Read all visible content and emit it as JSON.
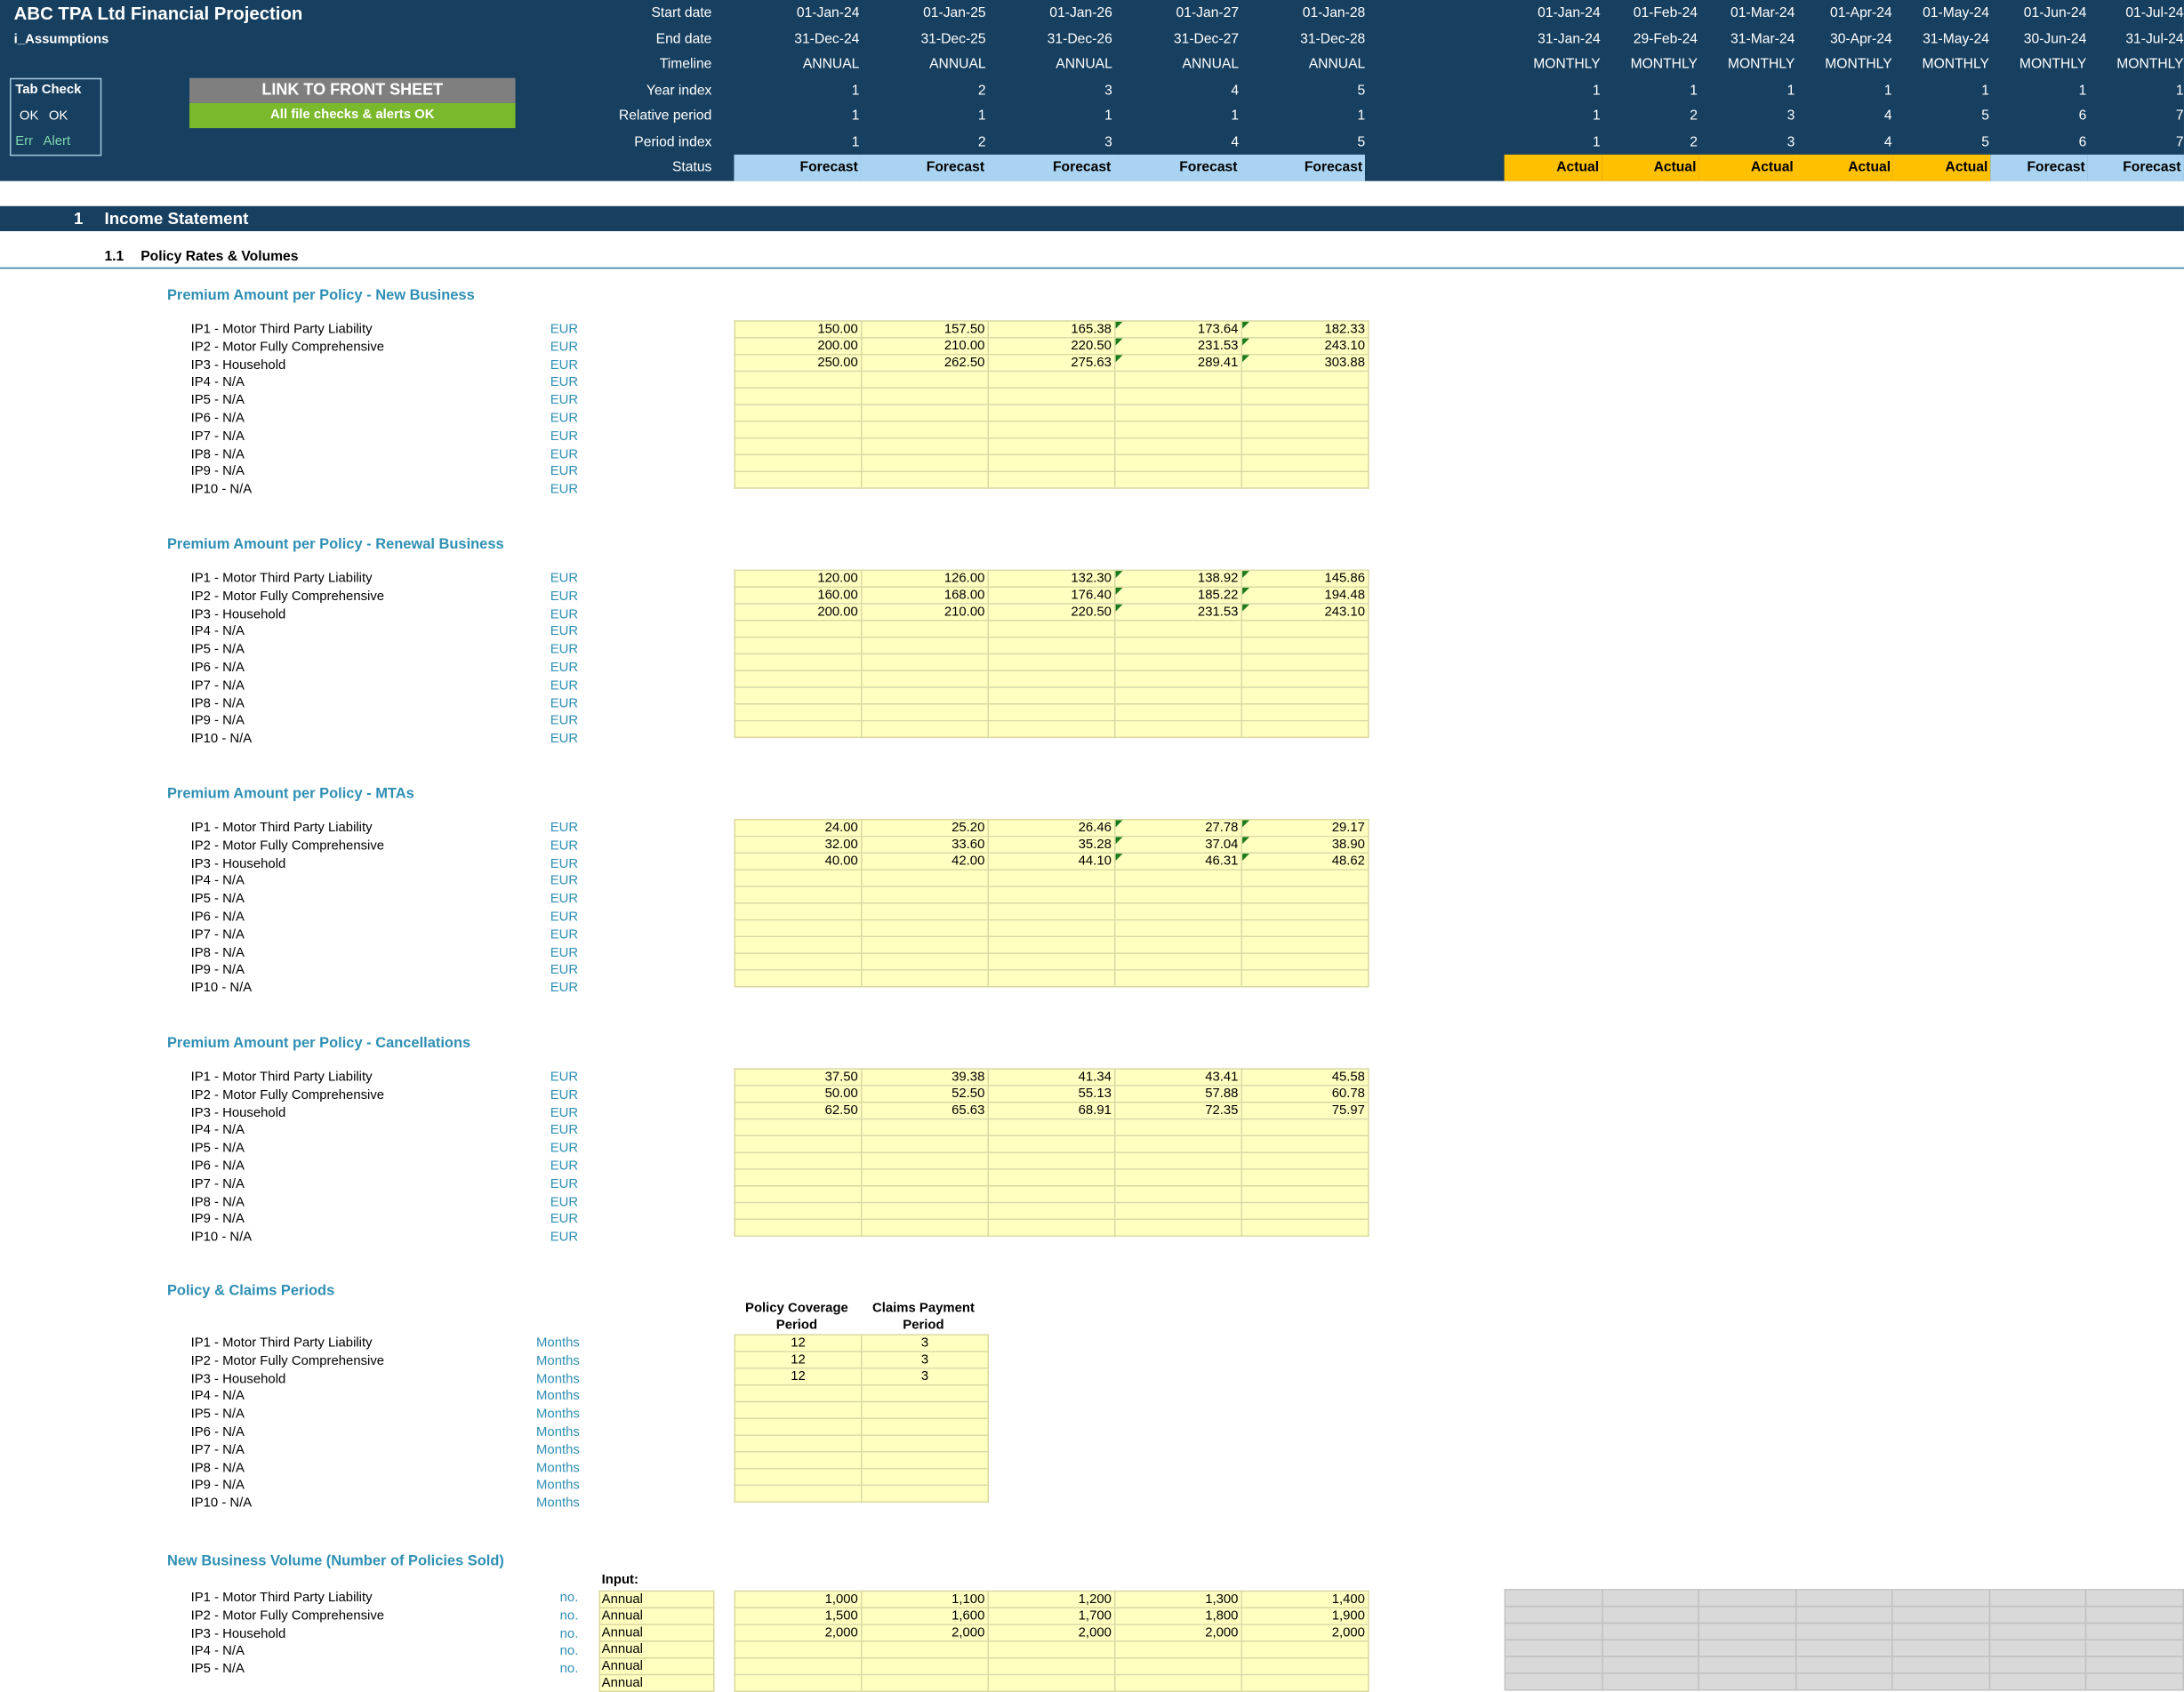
{
  "header": {
    "title": "ABC TPA Ltd Financial Projection",
    "sheet_name": "i_Assumptions",
    "tab_check": {
      "title": "Tab Check",
      "ok1": "OK",
      "ok2": "OK",
      "err": "Err",
      "alert": "Alert"
    },
    "link_button": "LINK TO FRONT SHEET",
    "checks_status": "All file checks & alerts OK",
    "row_labels": [
      "Start date",
      "End date",
      "Timeline",
      "Year index",
      "Relative period",
      "Period index",
      "Status"
    ],
    "annual": {
      "start": [
        "01-Jan-24",
        "01-Jan-25",
        "01-Jan-26",
        "01-Jan-27",
        "01-Jan-28"
      ],
      "end": [
        "31-Dec-24",
        "31-Dec-25",
        "31-Dec-26",
        "31-Dec-27",
        "31-Dec-28"
      ],
      "timeline": [
        "ANNUAL",
        "ANNUAL",
        "ANNUAL",
        "ANNUAL",
        "ANNUAL"
      ],
      "year_index": [
        "1",
        "2",
        "3",
        "4",
        "5"
      ],
      "relative": [
        "1",
        "1",
        "1",
        "1",
        "1"
      ],
      "period_index": [
        "1",
        "2",
        "3",
        "4",
        "5"
      ],
      "status": [
        "Forecast",
        "Forecast",
        "Forecast",
        "Forecast",
        "Forecast"
      ]
    },
    "monthly": {
      "start": [
        "01-Jan-24",
        "01-Feb-24",
        "01-Mar-24",
        "01-Apr-24",
        "01-May-24",
        "01-Jun-24",
        "01-Jul-24"
      ],
      "end": [
        "31-Jan-24",
        "29-Feb-24",
        "31-Mar-24",
        "30-Apr-24",
        "31-May-24",
        "30-Jun-24",
        "31-Jul-24"
      ],
      "timeline": [
        "MONTHLY",
        "MONTHLY",
        "MONTHLY",
        "MONTHLY",
        "MONTHLY",
        "MONTHLY",
        "MONTHLY"
      ],
      "year_index": [
        "1",
        "1",
        "1",
        "1",
        "1",
        "1",
        "1"
      ],
      "relative": [
        "1",
        "2",
        "3",
        "4",
        "5",
        "6",
        "7"
      ],
      "period_index": [
        "1",
        "2",
        "3",
        "4",
        "5",
        "6",
        "7"
      ],
      "status": [
        "Actual",
        "Actual",
        "Actual",
        "Actual",
        "Actual",
        "Forecast",
        "Forecast"
      ]
    }
  },
  "section1": {
    "number": "1",
    "label": "Income Statement"
  },
  "section11": {
    "number": "1.1",
    "label": "Policy Rates & Volumes"
  },
  "products": [
    "IP1 - Motor Third Party Liability",
    "IP2 - Motor Fully Comprehensive",
    "IP3 - Household",
    "IP4 - N/A",
    "IP5 - N/A",
    "IP6 - N/A",
    "IP7 - N/A",
    "IP8 - N/A",
    "IP9 - N/A",
    "IP10 - N/A"
  ],
  "blocks": [
    {
      "title": "Premium Amount per Policy - New Business",
      "unit": "EUR",
      "rows": [
        [
          "150.00",
          "157.50",
          "165.38",
          "173.64",
          "182.33"
        ],
        [
          "200.00",
          "210.00",
          "220.50",
          "231.53",
          "243.10"
        ],
        [
          "250.00",
          "262.50",
          "275.63",
          "289.41",
          "303.88"
        ]
      ]
    },
    {
      "title": "Premium Amount per Policy - Renewal Business",
      "unit": "EUR",
      "rows": [
        [
          "120.00",
          "126.00",
          "132.30",
          "138.92",
          "145.86"
        ],
        [
          "160.00",
          "168.00",
          "176.40",
          "185.22",
          "194.48"
        ],
        [
          "200.00",
          "210.00",
          "220.50",
          "231.53",
          "243.10"
        ]
      ]
    },
    {
      "title": "Premium Amount per Policy - MTAs",
      "unit": "EUR",
      "rows": [
        [
          "24.00",
          "25.20",
          "26.46",
          "27.78",
          "29.17"
        ],
        [
          "32.00",
          "33.60",
          "35.28",
          "37.04",
          "38.90"
        ],
        [
          "40.00",
          "42.00",
          "44.10",
          "46.31",
          "48.62"
        ]
      ]
    },
    {
      "title": "Premium Amount per Policy - Cancellations",
      "unit": "EUR",
      "rows": [
        [
          "37.50",
          "39.38",
          "41.34",
          "43.41",
          "45.58"
        ],
        [
          "50.00",
          "52.50",
          "55.13",
          "57.88",
          "60.78"
        ],
        [
          "62.50",
          "65.63",
          "68.91",
          "72.35",
          "75.97"
        ]
      ]
    }
  ],
  "periods": {
    "title": "Policy & Claims Periods",
    "unit": "Months",
    "col1": [
      "Policy Coverage",
      "Period"
    ],
    "col2": [
      "Claims Payment",
      "Period"
    ],
    "rows": [
      [
        "12",
        "3"
      ],
      [
        "12",
        "3"
      ],
      [
        "12",
        "3"
      ]
    ]
  },
  "volumes": {
    "title": "New Business Volume (Number of Policies Sold)",
    "unit": "no.",
    "input_label": "Input:",
    "input_values": [
      "Annual",
      "Annual",
      "Annual",
      "Annual",
      "Annual",
      "Annual"
    ],
    "rows": [
      [
        "1,000",
        "1,100",
        "1,200",
        "1,300",
        "1,400"
      ],
      [
        "1,500",
        "1,600",
        "1,700",
        "1,800",
        "1,900"
      ],
      [
        "2,000",
        "2,000",
        "2,000",
        "2,000",
        "2,000"
      ]
    ]
  }
}
